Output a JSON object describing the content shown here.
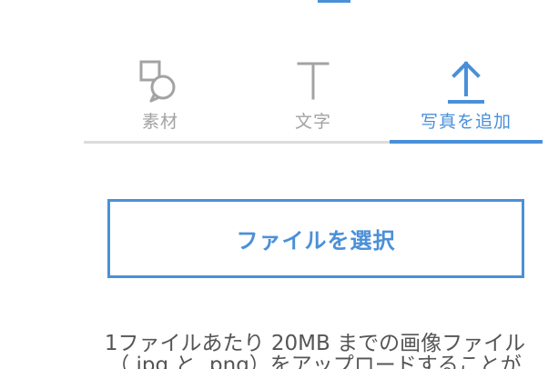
{
  "tabs": [
    {
      "label": "素材",
      "icon": "material-icon",
      "active": false
    },
    {
      "label": "文字",
      "icon": "text-icon",
      "active": false
    },
    {
      "label": "写真を追加",
      "icon": "upload-icon",
      "active": true
    }
  ],
  "upload": {
    "button_label": "ファイルを選択"
  },
  "note": {
    "line1": "1ファイルあたり 20MB までの画像ファイル",
    "line2": "（.jpg と .png）をアップロードすることが"
  },
  "colors": {
    "accent": "#4a90d9",
    "inactive_text": "#a3a3a3",
    "divider": "#dcdcdc",
    "body_text": "#555555"
  }
}
